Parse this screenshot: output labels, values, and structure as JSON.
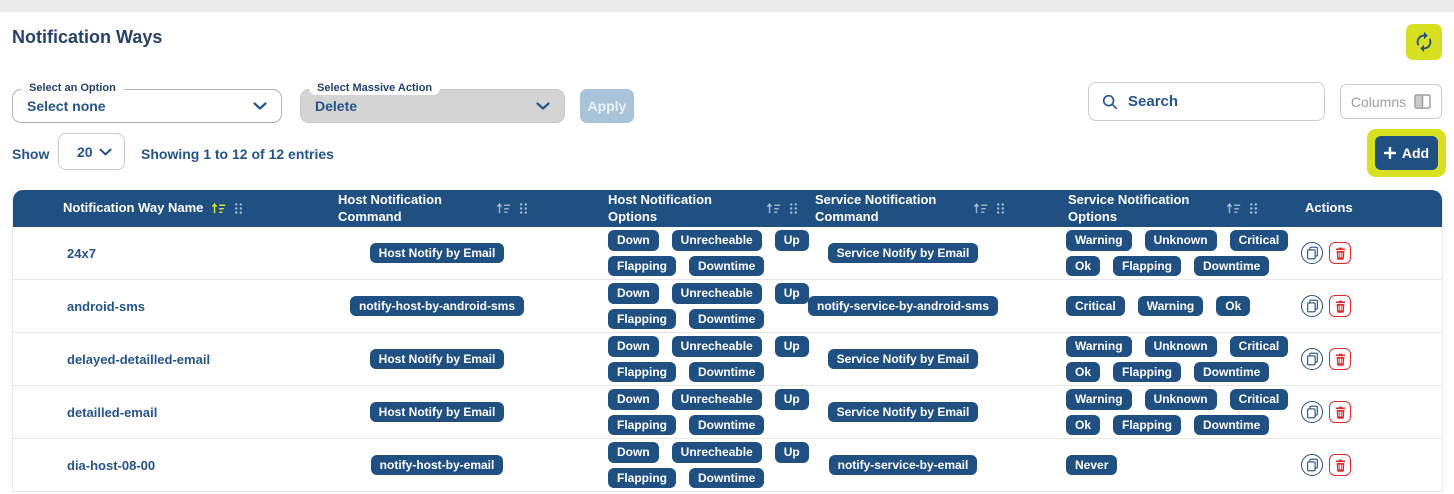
{
  "page": {
    "title": "Notification Ways"
  },
  "colors": {
    "accent_yellow": "#d9e021",
    "primary_blue": "#1f5081",
    "navy_text": "#25548a",
    "danger_red": "#e02b2b",
    "disabled_button_bg": "#a9c4d9"
  },
  "icons": {
    "refresh": "refresh-icon",
    "search": "search-icon",
    "columns": "columns-icon",
    "add_plus": "plus-icon",
    "sort": "sort-asc-icon",
    "drag": "drag-handle-icon",
    "duplicate": "duplicate-icon",
    "delete": "trash-icon",
    "chevron": "chevron-down-icon"
  },
  "toolbar": {
    "option_select": {
      "label": "Select an Option",
      "value": "Select none"
    },
    "massive_action_select": {
      "label": "Select Massive Action",
      "value": "Delete"
    },
    "apply_button": "Apply",
    "search": {
      "placeholder": "Search"
    },
    "columns_button": "Columns",
    "add_button": "Add"
  },
  "pagination": {
    "show_label": "Show",
    "page_size": "20",
    "summary": {
      "t1": "Showing 1 to ",
      "n1": "12",
      "t2": " of ",
      "n2": "12",
      "t3": " entries"
    }
  },
  "table": {
    "columns": [
      {
        "label": "Notification Way Name",
        "sortable": true,
        "sort_active": true
      },
      {
        "label": "Host Notification Command",
        "sortable": true,
        "sort_active": false
      },
      {
        "label": "Host Notification Options",
        "sortable": true,
        "sort_active": false
      },
      {
        "label": "Service Notification Command",
        "sortable": true,
        "sort_active": false
      },
      {
        "label": "Service Notification Options",
        "sortable": true,
        "sort_active": false
      },
      {
        "label": "Actions",
        "sortable": false,
        "sort_active": false
      }
    ],
    "rows": [
      {
        "name": "24x7",
        "host_command": "Host Notify by Email",
        "host_options": [
          [
            "Down",
            "Unrecheable",
            "Up"
          ],
          [
            "Flapping",
            "Downtime"
          ]
        ],
        "service_command": "Service Notify by Email",
        "service_options": [
          [
            "Warning",
            "Unknown",
            "Critical"
          ],
          [
            "Ok",
            "Flapping",
            "Downtime"
          ]
        ]
      },
      {
        "name": "android-sms",
        "host_command": "notify-host-by-android-sms",
        "host_options": [
          [
            "Down",
            "Unrecheable",
            "Up"
          ],
          [
            "Flapping",
            "Downtime"
          ]
        ],
        "service_command": "notify-service-by-android-sms",
        "service_options": [
          [
            "Critical",
            "Warning",
            "Ok"
          ]
        ]
      },
      {
        "name": "delayed-detailled-email",
        "host_command": "Host Notify by Email",
        "host_options": [
          [
            "Down",
            "Unrecheable",
            "Up"
          ],
          [
            "Flapping",
            "Downtime"
          ]
        ],
        "service_command": "Service Notify by Email",
        "service_options": [
          [
            "Warning",
            "Unknown",
            "Critical"
          ],
          [
            "Ok",
            "Flapping",
            "Downtime"
          ]
        ]
      },
      {
        "name": "detailled-email",
        "host_command": "Host Notify by Email",
        "host_options": [
          [
            "Down",
            "Unrecheable",
            "Up"
          ],
          [
            "Flapping",
            "Downtime"
          ]
        ],
        "service_command": "Service Notify by Email",
        "service_options": [
          [
            "Warning",
            "Unknown",
            "Critical"
          ],
          [
            "Ok",
            "Flapping",
            "Downtime"
          ]
        ]
      },
      {
        "name": "dia-host-08-00",
        "host_command": "notify-host-by-email",
        "host_options": [
          [
            "Down",
            "Unrecheable",
            "Up"
          ],
          [
            "Flapping",
            "Downtime"
          ]
        ],
        "service_command": "notify-service-by-email",
        "service_options": [
          [
            "Never"
          ]
        ]
      }
    ]
  }
}
